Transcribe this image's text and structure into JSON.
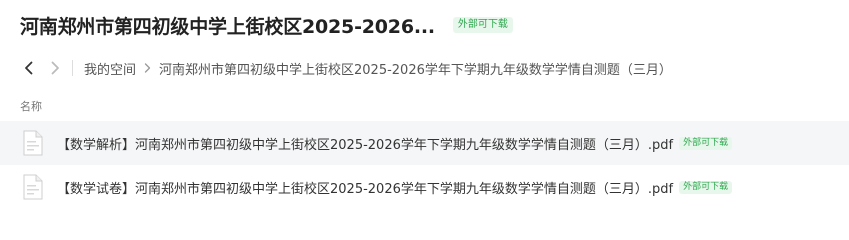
{
  "header": {
    "title": "河南郑州市第四初级中学上街校区2025-2026...",
    "download_badge": "外部可下载"
  },
  "breadcrumb": {
    "items": [
      {
        "label": "我的空间"
      },
      {
        "label": "河南郑州市第四初级中学上街校区2025-2026学年下学期九年级数学学情自测题（三月）"
      }
    ]
  },
  "table": {
    "column_name": "名称",
    "rows": [
      {
        "name": "【数学解析】河南郑州市第四初级中学上街校区2025-2026学年下学期九年级数学学情自测题（三月）.pdf",
        "badge": "外部可下载",
        "icon": "pdf-file-icon",
        "selected": true
      },
      {
        "name": "【数学试卷】河南郑州市第四初级中学上街校区2025-2026学年下学期九年级数学学情自测题（三月）.pdf",
        "badge": "外部可下载",
        "icon": "pdf-file-icon",
        "selected": false
      }
    ]
  },
  "colors": {
    "badge_bg": "#e8f7ec",
    "badge_text": "#2fa84f",
    "selected_row_bg": "#f5f6f7"
  }
}
